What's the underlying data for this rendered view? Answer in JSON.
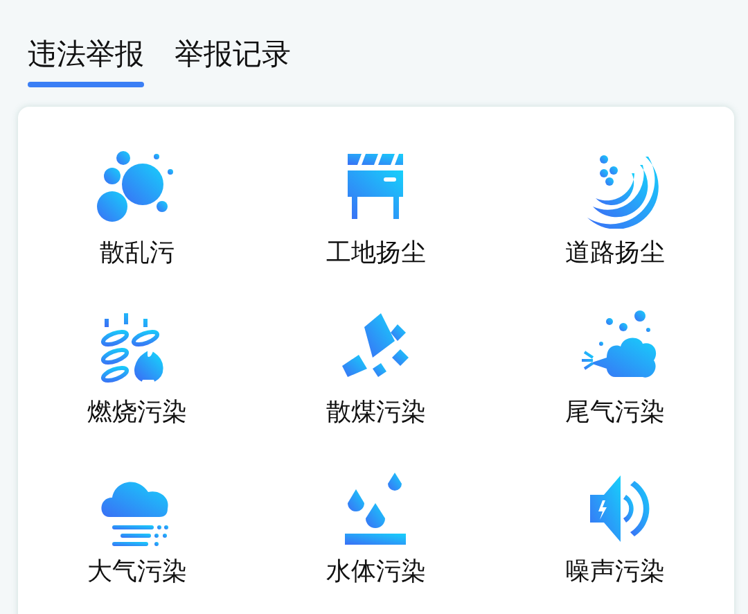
{
  "tabs": [
    {
      "label": "违法举报",
      "selected": true
    },
    {
      "label": "举报记录",
      "selected": false
    }
  ],
  "categories": [
    {
      "kind": "scatter",
      "label": "散乱污"
    },
    {
      "kind": "construction",
      "label": "工地扬尘"
    },
    {
      "kind": "road",
      "label": "道路扬尘"
    },
    {
      "kind": "burning",
      "label": "燃烧污染"
    },
    {
      "kind": "coal",
      "label": "散煤污染"
    },
    {
      "kind": "exhaust",
      "label": "尾气污染"
    },
    {
      "kind": "air",
      "label": "大气污染"
    },
    {
      "kind": "water",
      "label": "水体污染"
    },
    {
      "kind": "noise",
      "label": "噪声污染"
    }
  ]
}
